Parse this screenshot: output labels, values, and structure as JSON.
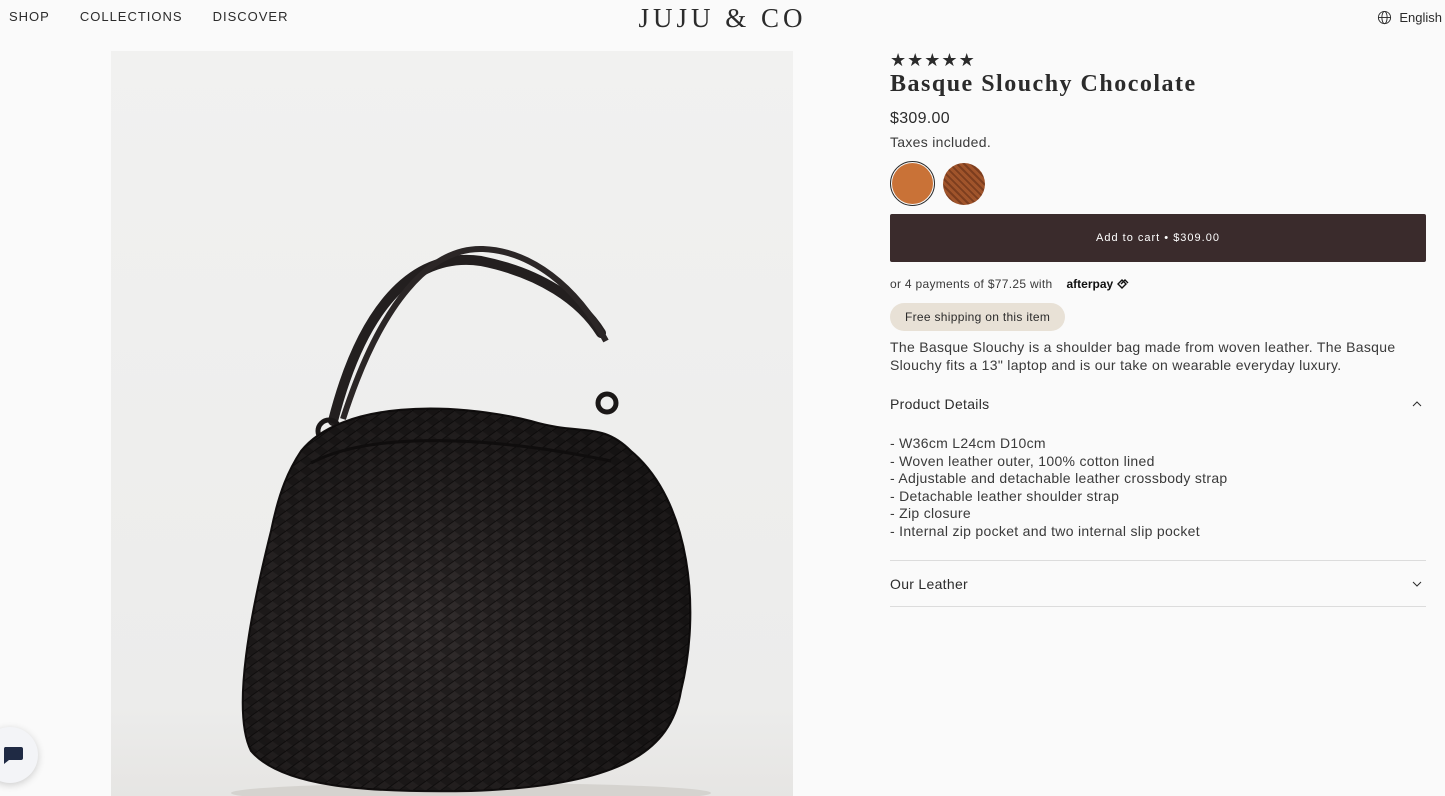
{
  "header": {
    "nav": [
      "SHOP",
      "COLLECTIONS",
      "DISCOVER"
    ],
    "logo": "JUJU & CO",
    "language": "English"
  },
  "product": {
    "stars": [
      "★",
      "★",
      "★",
      "★",
      "★"
    ],
    "rating": 5,
    "title": "Basque Slouchy Chocolate",
    "price": "$309.00",
    "taxes": "Taxes included.",
    "swatches": [
      {
        "color": "#c97237",
        "selected": true
      },
      {
        "color": "#a0542b",
        "selected": false
      }
    ],
    "add_to_cart": "Add to cart • $309.00",
    "afterpay_text": "or 4 payments of $77.25 with",
    "afterpay_logo": "afterpay",
    "shipping_badge": "Free shipping on this item",
    "description": "The Basque Slouchy is a shoulder bag made from woven leather. The Basque Slouchy fits a 13\" laptop and is our take on wearable everyday luxury.",
    "accordion_details": {
      "label": "Product Details",
      "items": [
        "- W36cm L24cm D10cm",
        "- Woven leather outer, 100% cotton lined",
        "- Adjustable and detachable leather crossbody strap",
        "- Detachable leather shoulder strap",
        "- Zip closure",
        "- Internal zip pocket and two internal slip pocket"
      ]
    },
    "accordion_leather": {
      "label": "Our Leather"
    }
  },
  "colors": {
    "accent": "#3a2b2c",
    "badge_bg": "#e8e1d6"
  }
}
